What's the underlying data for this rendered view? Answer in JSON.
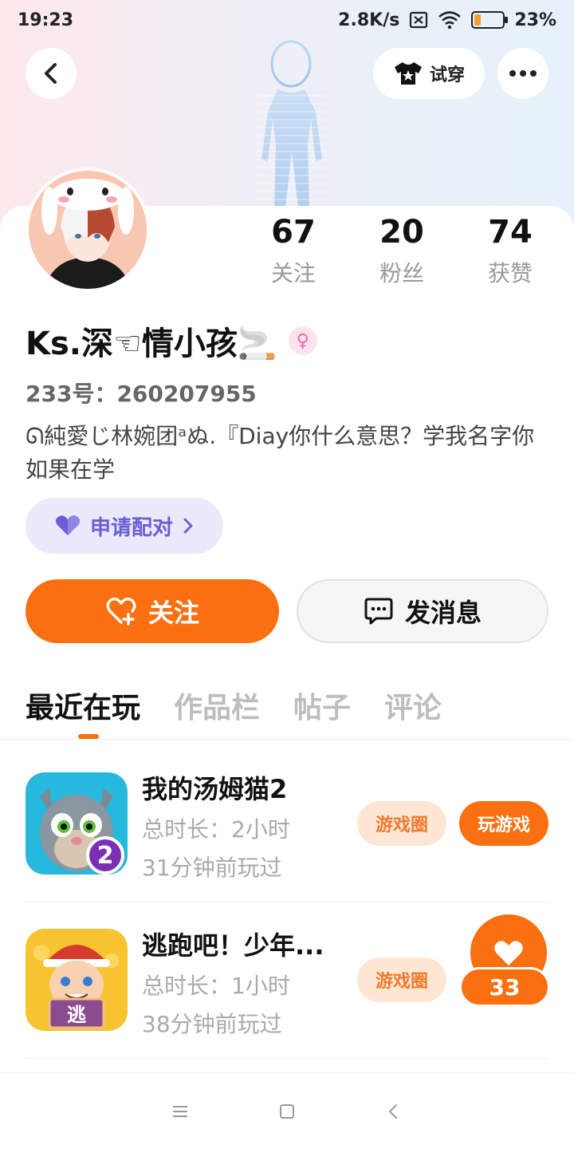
{
  "status_bar": {
    "time": "19:23",
    "network_speed": "2.8K/s",
    "battery": "23%",
    "battery_level": 0.23
  },
  "header": {
    "tryon_label": "试穿"
  },
  "profile": {
    "stats": [
      {
        "value": "67",
        "label": "关注"
      },
      {
        "value": "20",
        "label": "粉丝"
      },
      {
        "value": "74",
        "label": "获赞"
      }
    ],
    "username": "Ks.深☜情小孩🚬",
    "uid": "233号：260207955",
    "bio": "ᘏ純愛じ林婉团ᵃぬ.『Diay你什么意思？学我名字你如果在学",
    "pair_label": "申请配对",
    "follow_label": "关注",
    "message_label": "发消息"
  },
  "tabs": [
    "最近在玩",
    "作品栏",
    "帖子",
    "评论"
  ],
  "games": [
    {
      "title": "我的汤姆猫2",
      "duration": "总时长：2小时",
      "last_played": "31分钟前玩过",
      "circle_label": "游戏圈",
      "play_label": "玩游戏",
      "icon_badge": "2"
    },
    {
      "title": "逃跑吧！少年...",
      "duration": "总时长：1小时",
      "last_played": "38分钟前玩过",
      "circle_label": "游戏圈",
      "icon_badge": "逃"
    }
  ],
  "like_float": {
    "count": "33"
  },
  "colors": {
    "accent": "#fa6f10",
    "pair": "#6a5fd6"
  }
}
